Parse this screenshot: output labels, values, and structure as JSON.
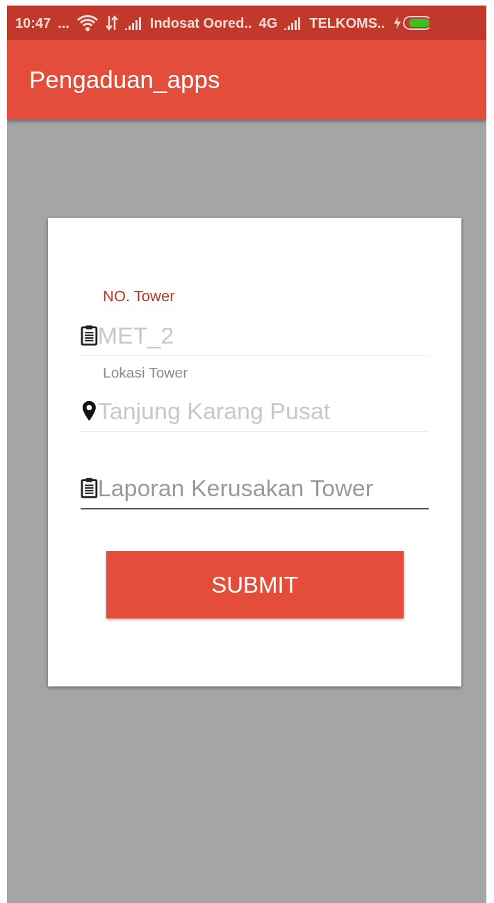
{
  "status_bar": {
    "time": "10:47",
    "more": "...",
    "carrier_1": "Indosat Oored..",
    "network_type": "4G",
    "carrier_2": "TELKOMS.."
  },
  "app_bar": {
    "title": "Pengaduan_apps"
  },
  "form": {
    "fields": [
      {
        "label": "NO. Tower",
        "value": "MET_2",
        "kind": "clipboard",
        "disabled": true,
        "focused": true
      },
      {
        "label": "Lokasi Tower",
        "value": "Tanjung Karang Pusat",
        "kind": "location",
        "disabled": true,
        "focused": false
      },
      {
        "placeholder": "Laporan Kerusakan Tower",
        "kind": "clipboard",
        "disabled": false,
        "focused": false
      }
    ],
    "submit": "SUBMIT"
  }
}
